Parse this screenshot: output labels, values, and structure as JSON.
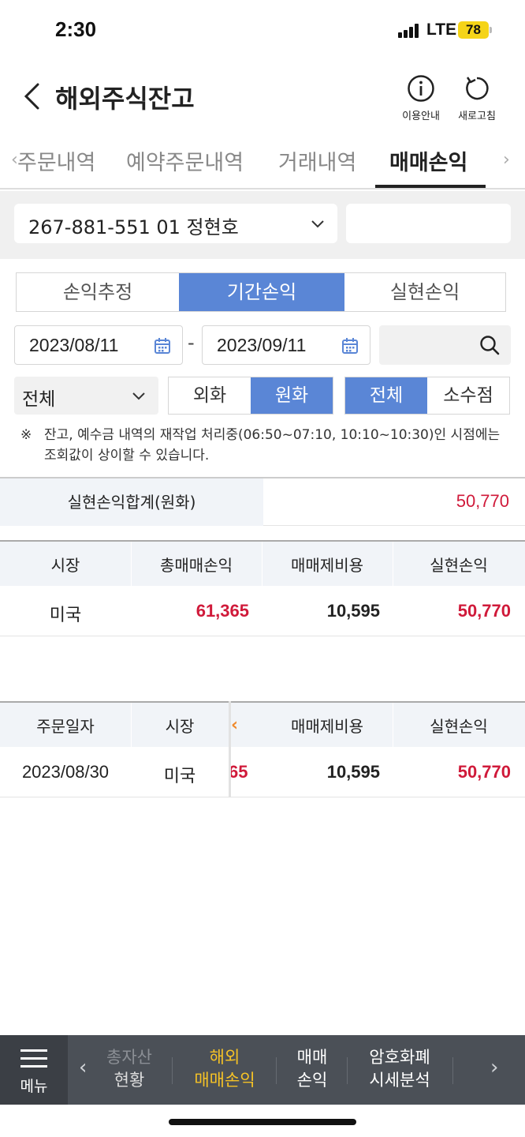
{
  "status_bar": {
    "time": "2:30",
    "network": "LTE",
    "battery": "78"
  },
  "header": {
    "title": "해외주식잔고",
    "info_label": "이용안내",
    "refresh_label": "새로고침"
  },
  "tabs": [
    {
      "label": "주문내역"
    },
    {
      "label": "예약주문내역"
    },
    {
      "label": "거래내역"
    },
    {
      "label": "매매손익",
      "active": true
    }
  ],
  "account": {
    "value": "267-881-551 01 정현호"
  },
  "period_tabs": [
    {
      "label": "손익추정"
    },
    {
      "label": "기간손익",
      "active": true
    },
    {
      "label": "실현손익"
    }
  ],
  "date_range": {
    "start": "2023/08/11",
    "separator": "-",
    "end": "2023/09/11"
  },
  "filter": {
    "market_select": "전체"
  },
  "currency_toggle": [
    {
      "label": "외화"
    },
    {
      "label": "원화",
      "active": true
    }
  ],
  "unit_toggle": [
    {
      "label": "전체",
      "active": true
    },
    {
      "label": "소수점"
    }
  ],
  "notice": {
    "mark": "※",
    "text": "잔고, 예수금 내역의 재작업 처리중(06:50~07:10, 10:10~10:30)인 시점에는 조회값이 상이할 수 있습니다."
  },
  "summary": {
    "label": "실현손익합계(원화)",
    "value": "50,770"
  },
  "market_table": {
    "headers": [
      "시장",
      "총매매손익",
      "매매제비용",
      "실현손익"
    ],
    "rows": [
      {
        "market": "미국",
        "total_pl": "61,365",
        "cost": "10,595",
        "realized": "50,770"
      }
    ]
  },
  "order_table": {
    "headers": [
      "주문일자",
      "시장",
      "매매제비용",
      "실현손익"
    ],
    "rows": [
      {
        "date": "2023/08/30",
        "market": "미국",
        "partial": "65",
        "cost": "10,595",
        "realized": "50,770"
      }
    ]
  },
  "bottom_nav": {
    "menu_label": "메뉴",
    "items": [
      {
        "line1": "총자산",
        "line2": "현황"
      },
      {
        "line1": "해외",
        "line2": "매매손익",
        "active": true
      },
      {
        "line1": "매매",
        "line2": "손익"
      },
      {
        "line1": "암호화폐",
        "line2": "시세분석"
      }
    ]
  },
  "colors": {
    "accent_blue": "#5a86d6",
    "loss_red": "#d01a3a",
    "nav_active": "#f5c226",
    "nav_bg": "#4b5057"
  }
}
